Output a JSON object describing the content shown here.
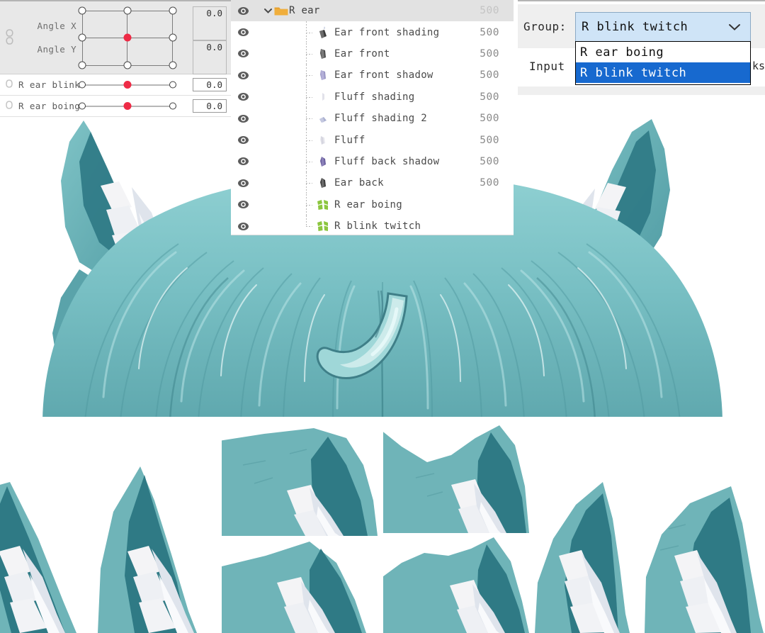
{
  "parameters": {
    "rows": [
      {
        "type": "group2d",
        "key_icon": "keyform-link-icon",
        "labels": [
          "Angle X",
          "Angle Y"
        ],
        "values": [
          "0.0",
          "0.0"
        ],
        "handle": {
          "col": 1,
          "row": 1
        }
      },
      {
        "type": "slider",
        "key_icon": "keyform-icon",
        "label": "R ear blink",
        "value": "0.0",
        "handle_pct": 50
      },
      {
        "type": "slider",
        "key_icon": "keyform-icon",
        "label": "R ear boing",
        "value": "0.0",
        "handle_pct": 50
      }
    ]
  },
  "layers": {
    "rows": [
      {
        "name": "R ear",
        "icon": "folder-icon",
        "opacity": "500",
        "kind": "folder",
        "selected": true,
        "depth": 0,
        "faded": true
      },
      {
        "name": "Ear front shading",
        "icon": "art-mesh-icon",
        "opacity": "500",
        "kind": "art",
        "selected": false,
        "depth": 1,
        "faded": false
      },
      {
        "name": "Ear front",
        "icon": "art-mesh-icon",
        "opacity": "500",
        "kind": "art",
        "selected": false,
        "depth": 1,
        "faded": false
      },
      {
        "name": "Ear front shadow",
        "icon": "art-mesh-icon",
        "opacity": "500",
        "kind": "art",
        "selected": false,
        "depth": 1,
        "faded": false
      },
      {
        "name": "Fluff shading",
        "icon": "art-mesh-icon",
        "opacity": "500",
        "kind": "art",
        "selected": false,
        "depth": 1,
        "faded": false
      },
      {
        "name": "Fluff shading 2",
        "icon": "art-mesh-icon",
        "opacity": "500",
        "kind": "art",
        "selected": false,
        "depth": 1,
        "faded": false
      },
      {
        "name": "Fluff",
        "icon": "art-mesh-icon",
        "opacity": "500",
        "kind": "art",
        "selected": false,
        "depth": 1,
        "faded": false
      },
      {
        "name": "Fluff back shadow",
        "icon": "art-mesh-icon",
        "opacity": "500",
        "kind": "art",
        "selected": false,
        "depth": 1,
        "faded": false
      },
      {
        "name": "Ear back",
        "icon": "art-mesh-icon",
        "opacity": "500",
        "kind": "art",
        "selected": false,
        "depth": 1,
        "faded": false
      },
      {
        "name": "R ear boing",
        "icon": "warp-deformer-icon",
        "opacity": "",
        "kind": "deformer",
        "selected": false,
        "depth": 1,
        "faded": false
      },
      {
        "name": "R blink twitch",
        "icon": "warp-deformer-icon",
        "opacity": "",
        "kind": "deformer",
        "selected": false,
        "depth": 1,
        "faded": false
      }
    ]
  },
  "inspector": {
    "group_label": "Group:",
    "group_value": "R blink twitch",
    "group_options": [
      "R ear boing",
      "R blink twitch"
    ],
    "group_selected": "R blink twitch",
    "input_label": "Input",
    "input_tail": "ks",
    "dropdown_arrow_icon": "chevron-down-icon"
  },
  "colors": {
    "accent_red": "#ee2b46",
    "selection_blue": "#1769cf",
    "combo_fill": "#cfe4f7",
    "folder_orange": "#f0ae3c",
    "deformer_green": "#8cc63f",
    "hair_teal": "#6db5b8",
    "hair_teal_dark": "#2f7a85",
    "fluff_white": "#f2f2f2"
  }
}
